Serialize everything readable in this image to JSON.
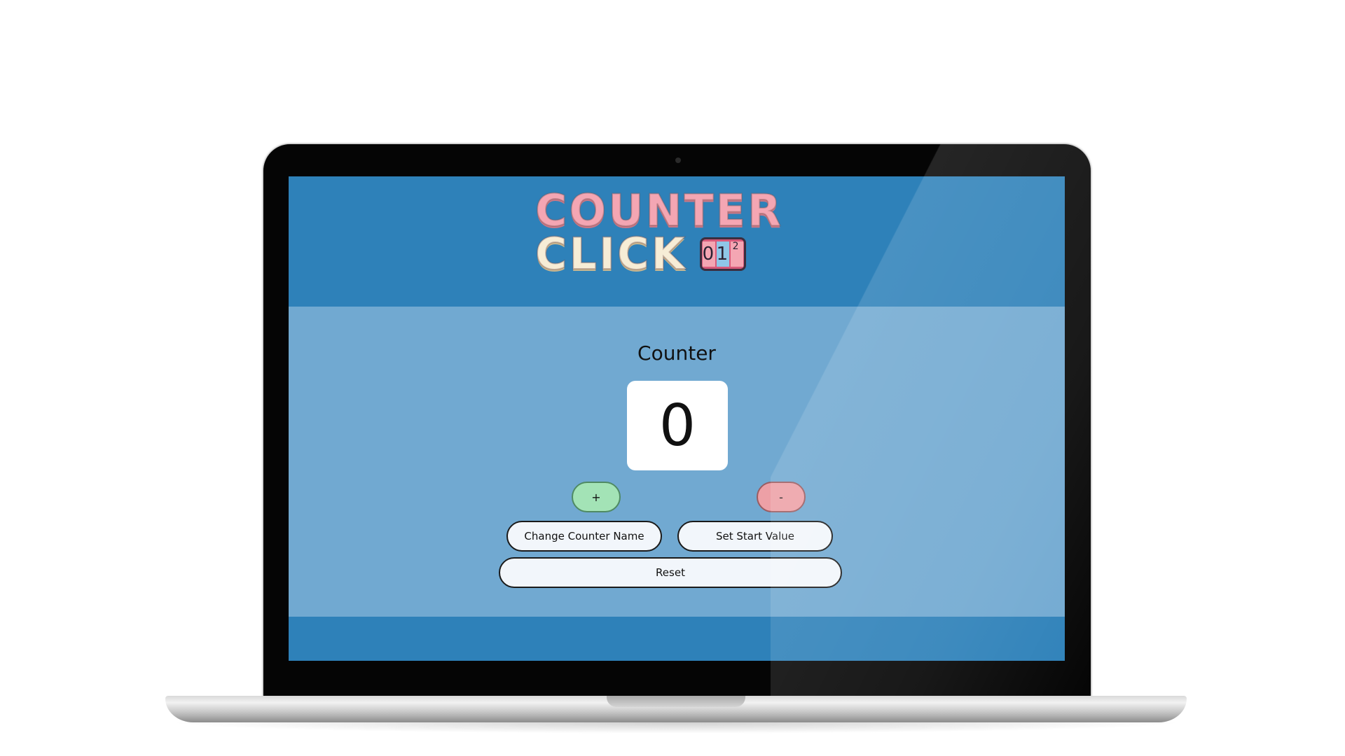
{
  "logo": {
    "line1": "COUNTER",
    "line2": "CLICK",
    "odometer_digits": [
      "0",
      "1",
      "2"
    ]
  },
  "counter": {
    "name": "Counter",
    "value": "0"
  },
  "buttons": {
    "increment": "+",
    "decrement": "-",
    "change_name": "Change Counter Name",
    "set_start": "Set Start Value",
    "reset": "Reset"
  },
  "colors": {
    "header_bg": "#2e81b9",
    "main_bg": "#71a9d1",
    "increment_bg": "#a3e3b6",
    "decrement_bg": "#eda0a6",
    "logo_pink": "#f4a6b3",
    "logo_cream": "#f7edd6"
  }
}
